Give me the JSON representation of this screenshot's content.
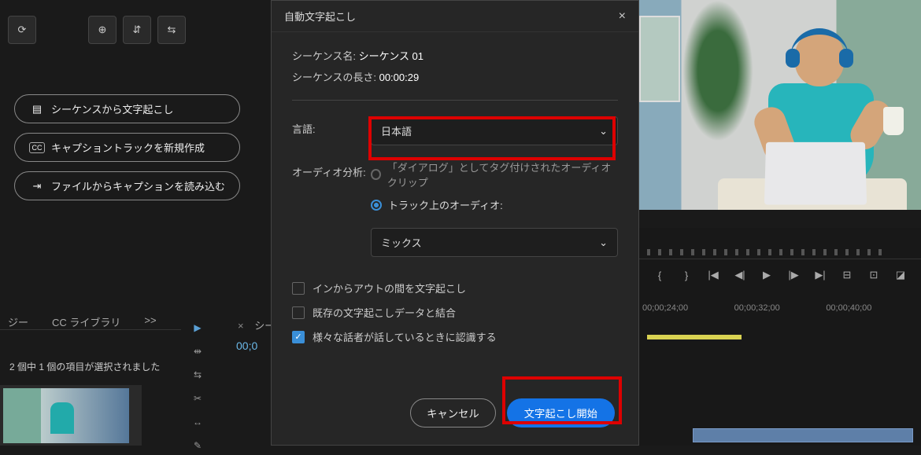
{
  "toolbar": {
    "refresh_icon": "refresh",
    "add_icon": "add",
    "expand_icon": "expand",
    "collapse_icon": "collapse"
  },
  "sidebar": {
    "btn1": "シーケンスから文字起こし",
    "btn2": "キャプショントラックを新規作成",
    "btn3": "ファイルからキャプションを読み込む"
  },
  "left_panel": {
    "tab1": "ジー",
    "tab2": "CC ライブラリ",
    "status": "2 個中 1 個の項目が選択されました",
    "chevrons": ">>"
  },
  "seq_panel": {
    "close": "×",
    "tab": "シー",
    "timecode": "00;0"
  },
  "dialog": {
    "title": "自動文字起こし",
    "seq_name_label": "シーケンス名:",
    "seq_name_value": "シーケンス 01",
    "seq_len_label": "シーケンスの長さ:",
    "seq_len_value": "00:00:29",
    "lang_label": "言語:",
    "lang_value": "日本語",
    "analysis_label": "オーディオ分析:",
    "radio1": "「ダイアログ」としてタグ付けされたオーディオクリップ",
    "radio2": "トラック上のオーディオ:",
    "track_value": "ミックス",
    "check1": "インからアウトの間を文字起こし",
    "check2": "既存の文字起こしデータと結合",
    "check3": "様々な話者が話しているときに認識する",
    "cancel": "キャンセル",
    "start": "文字起こし開始"
  },
  "timeline": {
    "t1": "00;00;24;00",
    "t2": "00;00;32;00",
    "t3": "00;00;40;00"
  }
}
